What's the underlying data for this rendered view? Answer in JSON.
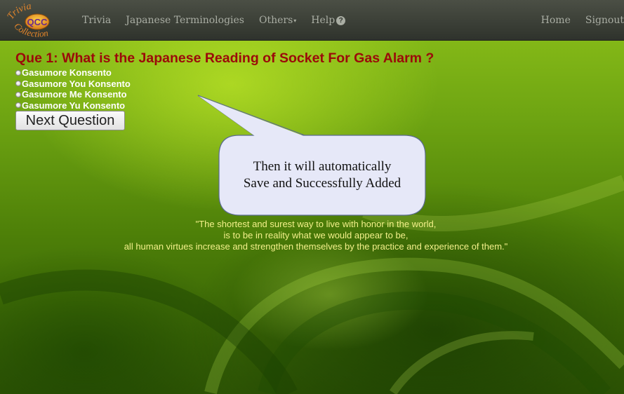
{
  "logo": {
    "top_text": "Trivia",
    "center_text": "QCC",
    "bottom_text": "Collection"
  },
  "nav": {
    "items": [
      {
        "label": "Trivia"
      },
      {
        "label": "Japanese Terminologies"
      },
      {
        "label": "Others",
        "caret": "▾"
      },
      {
        "label": "Help",
        "icon": "question-circle-icon",
        "icon_glyph": "?"
      }
    ],
    "right": {
      "home": "Home",
      "signout": "Signout"
    }
  },
  "quiz": {
    "question": "Que 1: What is the Japanese Reading of Socket For Gas Alarm ?",
    "options": [
      "Gasumore Konsento",
      "Gasumore You Konsento",
      "Gasumore Me Konsento",
      "Gasumore Yu Konsento"
    ],
    "next_label": "Next Question"
  },
  "callout": {
    "line1": "Then it will automatically",
    "line2": "Save and Successfully Added"
  },
  "quote": {
    "line1": "\"The shortest and surest way to live with honor in the world,",
    "line2": "is to be in reality what we would appear to be,",
    "line3": "all human virtues increase and strengthen themselves by the practice and experience of them.\""
  },
  "colors": {
    "question": "#9b0a0a",
    "quote": "#f3f08a",
    "navbar": "#3a3e36",
    "background": "#6ea412"
  }
}
